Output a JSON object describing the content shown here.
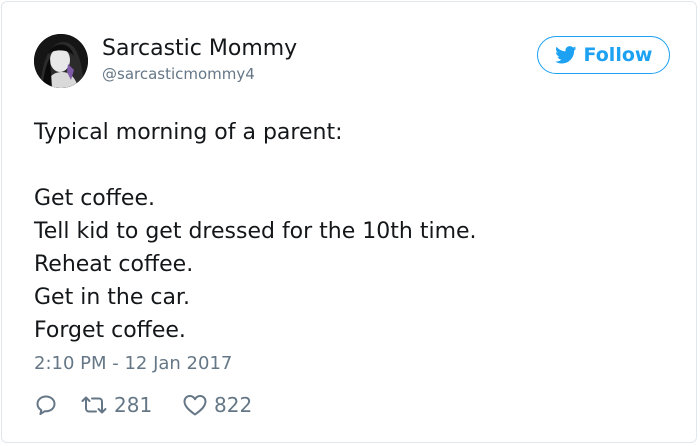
{
  "tweet": {
    "author": {
      "display_name": "Sarcastic Mommy",
      "handle": "@sarcasticmommy4",
      "avatar_icon": "profile-photo"
    },
    "follow_button": {
      "label": "Follow",
      "icon": "twitter-bird-icon"
    },
    "text_lines": [
      "Typical morning of a parent:",
      "",
      "Get coffee.",
      "Tell kid to get dressed for the 10th time.",
      "Reheat coffee.",
      "Get in the car.",
      "Forget coffee."
    ],
    "timestamp": "2:10 PM - 12 Jan 2017",
    "actions": {
      "reply_icon": "reply-icon",
      "retweet_icon": "retweet-icon",
      "retweet_count": "281",
      "like_icon": "heart-icon",
      "like_count": "822"
    }
  },
  "colors": {
    "brand": "#1da1f2",
    "text": "#14171a",
    "muted": "#657786",
    "border": "#e1e8ed"
  }
}
